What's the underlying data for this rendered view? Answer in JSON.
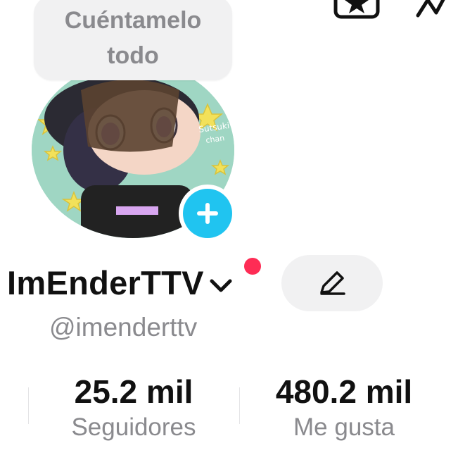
{
  "profile": {
    "bio_prompt": "Cuéntamelo todo",
    "display_name": "ImEnderTTV",
    "handle": "@imenderttv",
    "avatar_signature": "Sutsuki chan",
    "stats": [
      {
        "value": "25.2 mil",
        "label": "Seguidores"
      },
      {
        "value": "480.2 mil",
        "label": "Me gusta"
      }
    ]
  },
  "icons": {
    "top": [
      "star-box-icon",
      "activity-icon"
    ],
    "add": "plus-icon",
    "account_switch": "chevron-down-icon",
    "edit": "pencil-icon"
  },
  "colors": {
    "accent_blue": "#20c4f0",
    "notification_red": "#fe2c55",
    "muted_gray": "#8a8a8e",
    "pill_bg": "#f1f1f2"
  }
}
